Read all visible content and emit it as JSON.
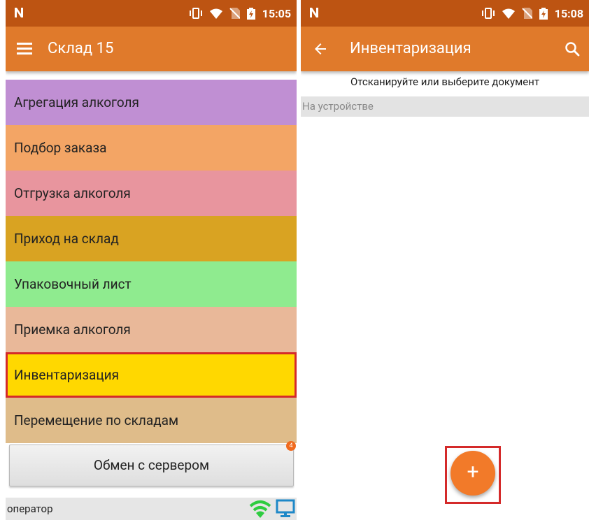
{
  "left_screen": {
    "status": {
      "time": "15:05"
    },
    "app_bar": {
      "title": "Склад 15"
    },
    "menu": [
      {
        "label": "Агрегация алкоголя",
        "color": "#c08fd3"
      },
      {
        "label": "Подбор заказа",
        "color": "#f3a565"
      },
      {
        "label": "Отгрузка алкоголя",
        "color": "#e8959e"
      },
      {
        "label": "Приход на склад",
        "color": "#d9a322"
      },
      {
        "label": "Упаковочный лист",
        "color": "#8feb8f"
      },
      {
        "label": "Приемка алкоголя",
        "color": "#e9b899"
      },
      {
        "label": "Инвентаризация",
        "color": "#ffd800",
        "selected": true
      },
      {
        "label": "Перемещение по складам",
        "color": "#dfbc8a"
      }
    ],
    "server_button": {
      "label": "Обмен с сервером",
      "badge": "4"
    },
    "footer": {
      "operator_label": "оператор"
    }
  },
  "right_screen": {
    "status": {
      "time": "15:08"
    },
    "app_bar": {
      "title": "Инвентаризация"
    },
    "scan_hint": "Отсканируйте или выберите документ",
    "section_header": "На устройстве",
    "fab": {
      "label": "+"
    }
  },
  "colors": {
    "status_bar": "#bd5412",
    "app_bar": "#e07a2b",
    "accent": "#f27a29",
    "highlight_border": "#d42a2a",
    "wifi": "#2ecc40",
    "monitor": "#1e88c8"
  }
}
